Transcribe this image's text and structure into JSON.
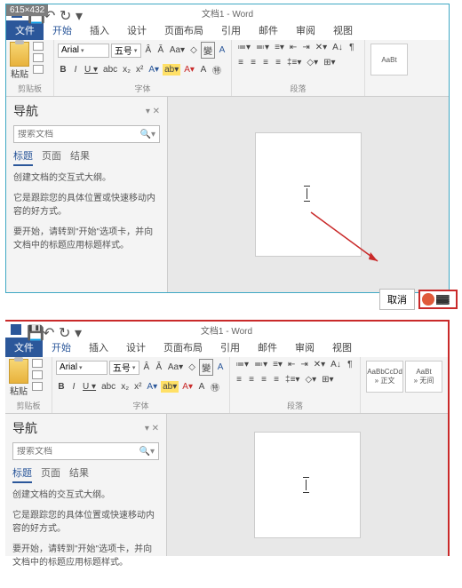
{
  "badge": "615×432",
  "title": "文档1 - Word",
  "tabs": {
    "file": "文件",
    "home": "开始",
    "insert": "插入",
    "design": "设计",
    "layout": "页面布局",
    "ref": "引用",
    "mail": "邮件",
    "review": "审阅",
    "view": "视图"
  },
  "ribbon": {
    "paste": "粘贴",
    "clipboard_label": "剪贴板",
    "font_name": "Arial",
    "font_size": "五号",
    "font_label": "字体",
    "para_label": "段落",
    "style1": "AaBbCcDd",
    "style1_name": "» 正文",
    "style2": "AaBt",
    "style2_name": "» 无间"
  },
  "nav": {
    "title": "导航",
    "search_placeholder": "搜索文档",
    "tab_title": "标题",
    "tab_page": "页面",
    "tab_result": "结果",
    "p1": "创建文档的交互式大纲。",
    "p2": "它是跟踪您的具体位置或快速移动内容的好方式。",
    "p3": "要开始，请转到\"开始\"选项卡，并向文档中的标题应用标题样式。"
  },
  "cancel": "取消"
}
